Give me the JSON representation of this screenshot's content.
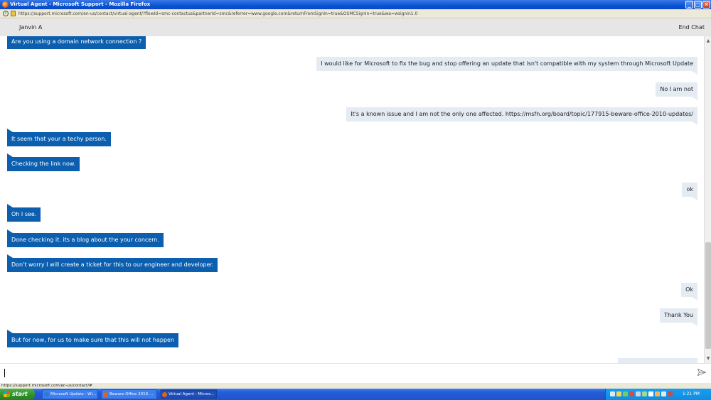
{
  "window": {
    "title": "Virtual Agent - Microsoft Support - Mozilla Firefox",
    "url": "https://support.microsoft.com/en-us/contact/virtual-agent/?flowId=smc-contactus&partnerId=smc&referrer=www.google.com&returnFromSignIn=true&OSMCSignIn=true&wa=wsignin1.0"
  },
  "chat": {
    "agent_name": "Janvin A",
    "end_chat_label": "End Chat",
    "messages": [
      {
        "from": "agent",
        "text": "Are you using a domain network connection ?"
      },
      {
        "from": "user",
        "text": "I would like for Microsoft to fix the bug and stop offering an update that isn't compatible with my system through Microsoft Update"
      },
      {
        "from": "user",
        "text": "No I am not"
      },
      {
        "from": "user",
        "text": "It's a known issue and I am not the only one affected. https://msfn.org/board/topic/177915-beware-office-2010-updates/"
      },
      {
        "from": "agent",
        "text": "It seem that your a techy person."
      },
      {
        "from": "agent",
        "text": "Checking the link now."
      },
      {
        "from": "user",
        "text": "ok"
      },
      {
        "from": "agent",
        "text": "Oh I see."
      },
      {
        "from": "agent",
        "text": "Done checking it. its a blog about the your concern."
      },
      {
        "from": "agent",
        "text": "Don't worry I will create a ticket for this to our engineer and developer."
      },
      {
        "from": "user",
        "text": "Ok"
      },
      {
        "from": "user",
        "text": "Thank You"
      },
      {
        "from": "agent",
        "text": "But for now, for us to make sure that this will not happen"
      }
    ],
    "input_value": ""
  },
  "statusbar": {
    "url": "https://support.microsoft.com/en-us/contact/#"
  },
  "taskbar": {
    "start_label": "start",
    "tasks": [
      {
        "label": "Microsoft Update - Wi...",
        "icon": "ie-icon",
        "color": "#2a7ad8"
      },
      {
        "label": "Beware Office 2010 ...",
        "icon": "firefox-icon",
        "color": "#e0631a"
      },
      {
        "label": "Virtual Agent - Micros...",
        "icon": "firefox-icon",
        "color": "#e0631a"
      }
    ],
    "clock": "1:21 PM"
  }
}
